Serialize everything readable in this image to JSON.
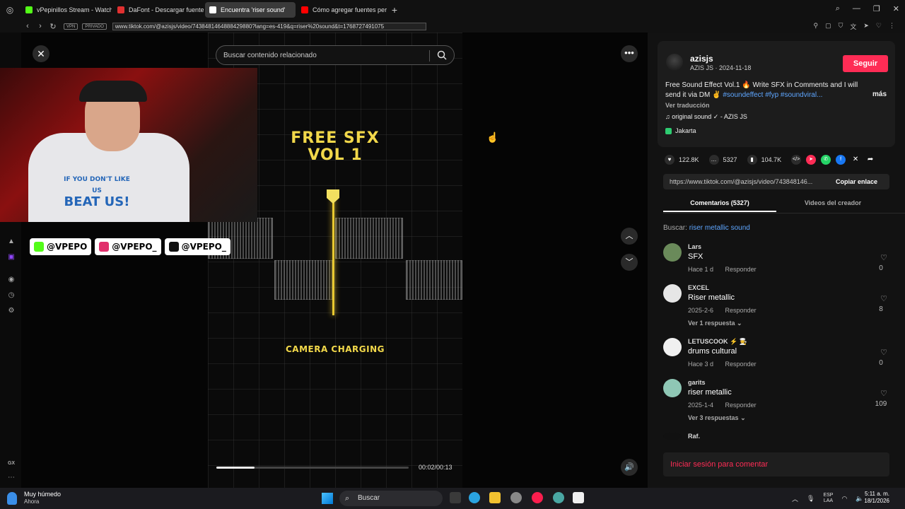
{
  "browser": {
    "tabs": [
      {
        "label": "vPepinillos Stream - Watch",
        "color": "#53fc18",
        "active": false
      },
      {
        "label": "DaFont - Descargar fuentes",
        "color": "#e03030",
        "active": false
      },
      {
        "label": "Encuentra 'riser sound'",
        "color": "#ffffff",
        "active": true
      },
      {
        "label": "Cómo agregar fuentes per",
        "color": "#ff0000",
        "active": false
      }
    ],
    "vpn_label": "VPN",
    "private_label": "PRIVADO",
    "url": "www.tiktok.com/@azisjs/video/7438481464888429880?lang=es-419&q=riser%20sound&t=1768727491075"
  },
  "video": {
    "search_placeholder": "Buscar contenido relacionado",
    "title_text": "FREE SFX\nVOL 1",
    "subtitle_text": "CAMERA CHARGING",
    "time": "00:02/00:13",
    "progress": 0.2
  },
  "webcam": {
    "shirt_line1": "IF YOU DON'T LIKE US",
    "shirt_line2": "BEAT US!"
  },
  "socials": [
    {
      "icon": "kick-icon",
      "handle": "@VPEPO",
      "color": "#53fc18"
    },
    {
      "icon": "instagram-icon",
      "handle": "@VPEPO_",
      "color": "#e1306c"
    },
    {
      "icon": "tiktok-icon",
      "handle": "@VPEPO_",
      "color": "#111111"
    }
  ],
  "creator": {
    "username": "azisjs",
    "meta": "AZIS JS · 2024-11-18",
    "follow_label": "Seguir",
    "description": "Free Sound Effect Vol.1 🔥 Write SFX in Comments and I will send it via DM ✌️",
    "hashtags": "#soundeffect #fyp #soundviral...",
    "more_label": "más",
    "translate_label": "Ver traducción",
    "music": "original sound ✓ - AZIS JS",
    "location": "Jakarta"
  },
  "actions": {
    "likes": "122.8K",
    "comments": "5327",
    "saves": "104.7K"
  },
  "share_link": {
    "url": "https://www.tiktok.com/@azisjs/video/743848146...",
    "copy_label": "Copiar enlace"
  },
  "comment_tabs": {
    "comments": "Comentarios (5327)",
    "creator_videos": "Videos del creador"
  },
  "search_query": {
    "label": "Buscar:",
    "query": "riser metallic sound"
  },
  "reply_label": "Responder",
  "comments": [
    {
      "user": "Lars",
      "text": "SFX",
      "time": "Hace 1 d",
      "replies": "",
      "likes": "0",
      "avatar": "#6a8a5a"
    },
    {
      "user": "EXCEL",
      "text": "Riser metallic",
      "time": "2025-2-6",
      "replies": "Ver 1 respuesta",
      "likes": "8",
      "avatar": "#e6e6e6"
    },
    {
      "user": "LETUSCOOK ⚡ 🧑‍🍳",
      "text": "drums cultural",
      "time": "Hace 3 d",
      "replies": "",
      "likes": "0",
      "avatar": "#f0f0f0"
    },
    {
      "user": "garits",
      "text": "riser metallic",
      "time": "2025-1-4",
      "replies": "Ver 3 respuestas",
      "likes": "109",
      "avatar": "#8fc7b5"
    },
    {
      "user": "Raf.",
      "text": "",
      "time": "",
      "replies": "",
      "likes": "",
      "avatar": "#111111"
    }
  ],
  "login_prompt": "Iniciar sesión para comentar",
  "taskbar": {
    "weather_title": "Muy húmedo",
    "weather_sub": "Ahora",
    "search_label": "Buscar",
    "lang_1": "ESP",
    "lang_2": "LAA",
    "time": "5:11 a. m.",
    "date": "18/1/2026"
  }
}
